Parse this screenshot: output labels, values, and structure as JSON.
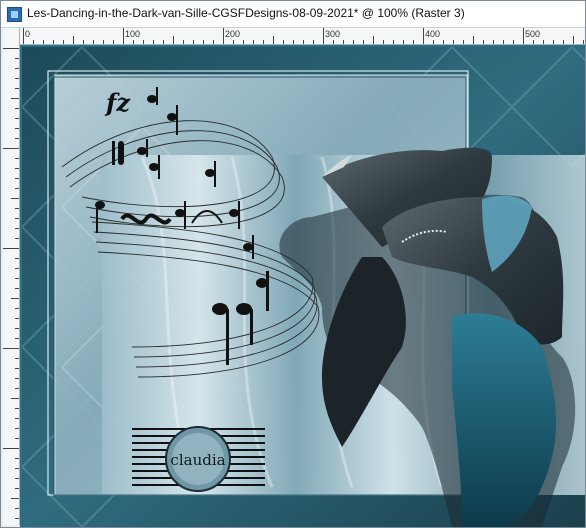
{
  "window": {
    "title": "Les-Dancing-in-the-Dark-van-Sille-CGSFDesigns-08-09-2021* @ 100% (Raster 3)"
  },
  "ruler": {
    "top_labels": [
      "0",
      "100",
      "200",
      "300",
      "400",
      "500"
    ]
  },
  "artwork": {
    "watermark_text": "claudia",
    "music_mark": "fz",
    "colors": {
      "dark_teal": "#1f4b5a",
      "mid_teal": "#3e7d92",
      "light_blue": "#b9d4df",
      "ruler_bg": "#f4f6f8"
    }
  }
}
